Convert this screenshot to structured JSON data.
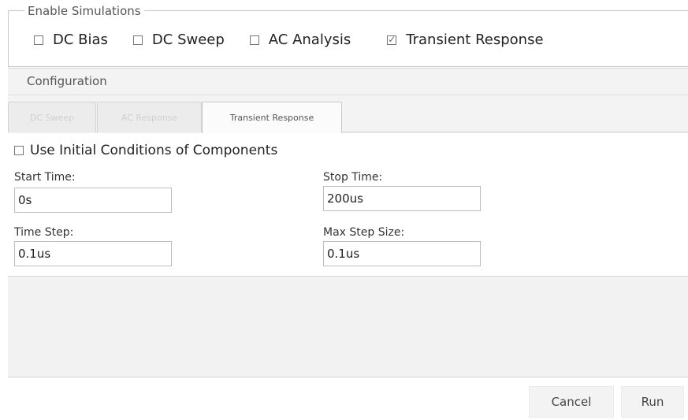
{
  "enable_simulations": {
    "legend": "Enable Simulations",
    "options": [
      {
        "label": "DC Bias",
        "checked": false
      },
      {
        "label": "DC Sweep",
        "checked": false
      },
      {
        "label": "AC Analysis",
        "checked": false
      },
      {
        "label": "Transient Response",
        "checked": true
      }
    ]
  },
  "configuration": {
    "title": "Configuration",
    "tabs": [
      {
        "label": "DC Sweep",
        "active": false
      },
      {
        "label": "AC Response",
        "active": false
      },
      {
        "label": "Transient Response",
        "active": true
      }
    ],
    "transient": {
      "use_initial_conditions_label": "Use Initial Conditions of Components",
      "use_initial_conditions_checked": false,
      "start_time_label": "Start Time:",
      "start_time_value": "0s",
      "stop_time_label": "Stop Time:",
      "stop_time_value": "200us",
      "time_step_label": "Time Step:",
      "time_step_value": "0.1us",
      "max_step_size_label": "Max Step Size:",
      "max_step_size_value": "0.1us"
    }
  },
  "footer": {
    "cancel_label": "Cancel",
    "run_label": "Run"
  }
}
